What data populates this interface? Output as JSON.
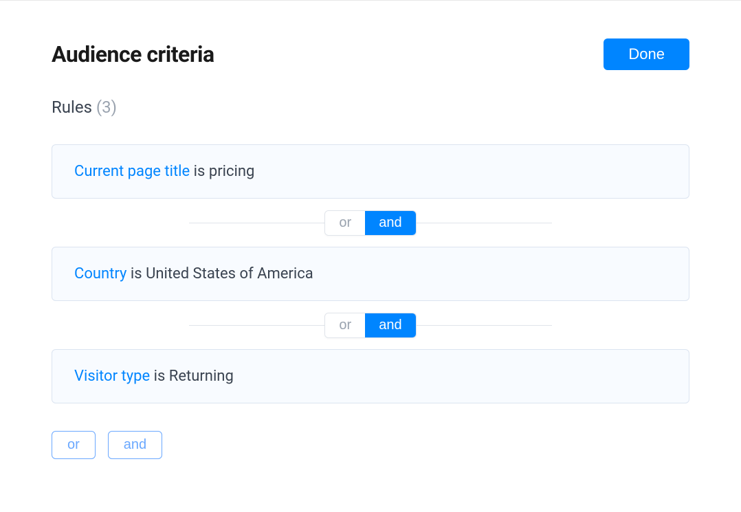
{
  "header": {
    "title": "Audience criteria",
    "done_label": "Done"
  },
  "rules_section": {
    "label": "Rules",
    "count_display": "(3)"
  },
  "rules": [
    {
      "attribute": "Current page title",
      "operator": "is",
      "value": "pricing"
    },
    {
      "attribute": "Country",
      "operator": "is",
      "value": "United States of America"
    },
    {
      "attribute": "Visitor type",
      "operator": "is",
      "value": "Returning"
    }
  ],
  "connectors": [
    {
      "or_label": "or",
      "and_label": "and",
      "active": "and"
    },
    {
      "or_label": "or",
      "and_label": "and",
      "active": "and"
    }
  ],
  "bottom_actions": {
    "or_label": "or",
    "and_label": "and"
  }
}
